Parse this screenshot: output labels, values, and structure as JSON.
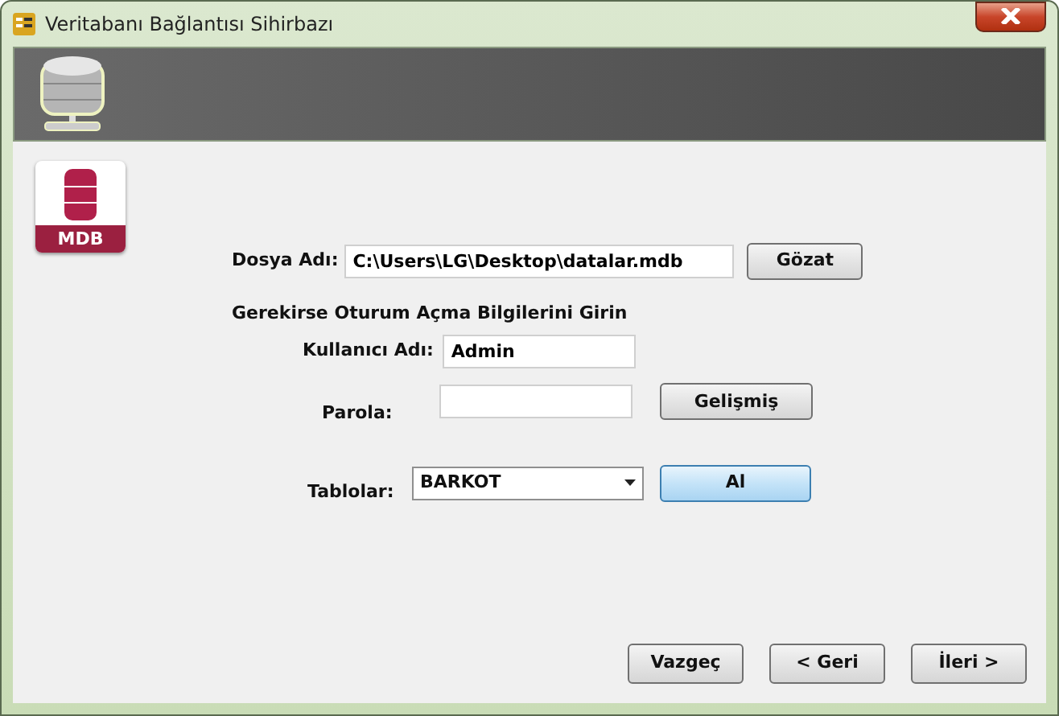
{
  "window": {
    "title": "Veritabanı Bağlantısı Sihirbazı"
  },
  "file": {
    "label": "Dosya Adı:",
    "value": "C:\\Users\\LG\\Desktop\\datalar.mdb",
    "button": "Gözat"
  },
  "file_badge": {
    "text": "MDB"
  },
  "login_heading": "Gerekirse Oturum Açma Bilgilerini Girin",
  "username": {
    "label": "Kullanıcı Adı:",
    "value": "Admin"
  },
  "password": {
    "label": "Parola:",
    "button": "Gelişmiş"
  },
  "tables": {
    "label": "Tablolar:",
    "value": "BARKOT",
    "button": "Al",
    "button_default": true
  },
  "buttons": [
    {
      "label": "Vazgeç"
    },
    {
      "label": "< Geri"
    },
    {
      "label": "İleri >"
    }
  ]
}
